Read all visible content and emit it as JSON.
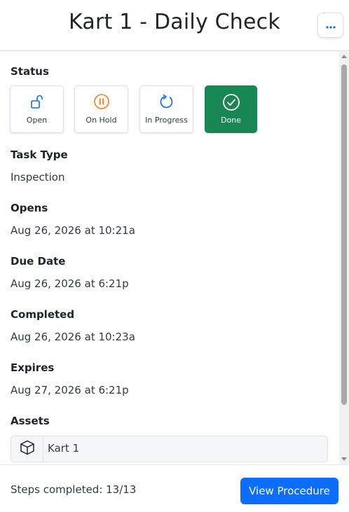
{
  "header": {
    "title": "Kart 1 - Daily Check",
    "more_icon": "ellipsis-icon"
  },
  "status": {
    "label": "Status",
    "options": [
      {
        "label": "Open",
        "icon": "unlock-icon",
        "color": "#0d6efd"
      },
      {
        "label": "On Hold",
        "icon": "pause-circle-icon",
        "color": "#fd7e14"
      },
      {
        "label": "In Progress",
        "icon": "refresh-icon",
        "color": "#0d6efd"
      },
      {
        "label": "Done",
        "icon": "check-circle-icon",
        "color": "#ffffff"
      }
    ],
    "selected": "Done",
    "selected_color": "#198754"
  },
  "task_type": {
    "label": "Task Type",
    "value": "Inspection"
  },
  "opens": {
    "label": "Opens",
    "value": "Aug 26, 2026 at 10:21a"
  },
  "due_date": {
    "label": "Due Date",
    "value": "Aug 26, 2026 at 6:21p"
  },
  "completed": {
    "label": "Completed",
    "value": "Aug 26, 2026 at 10:23a"
  },
  "expires": {
    "label": "Expires",
    "value": "Aug 27, 2026 at 6:21p"
  },
  "assets": {
    "label": "Assets",
    "items": [
      {
        "name": "Kart 1",
        "icon": "box-icon"
      }
    ]
  },
  "footer": {
    "steps_text": "Steps completed: 13/13",
    "view_button": "View Procedure",
    "accent": "#0d6efd"
  }
}
